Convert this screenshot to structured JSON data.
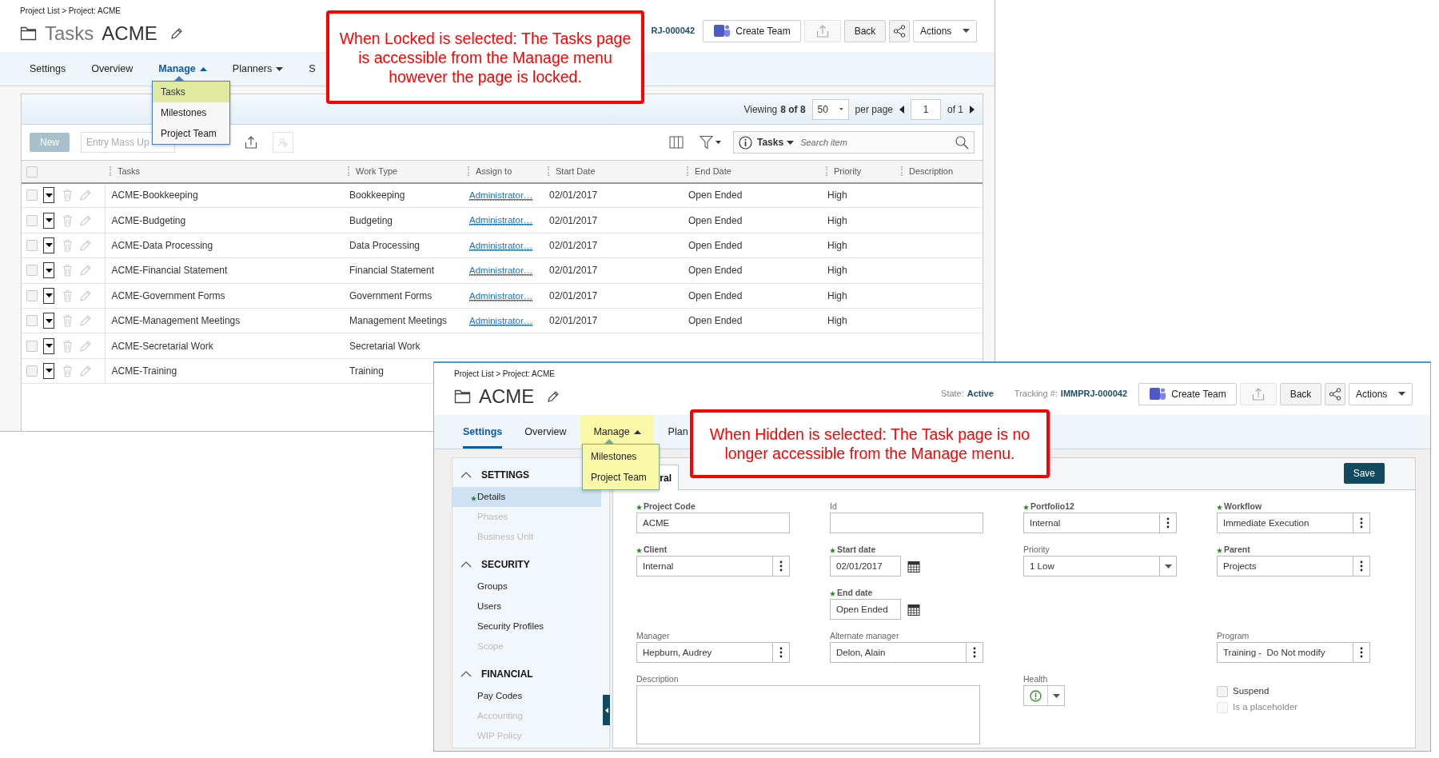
{
  "locked_view": {
    "breadcrumb": "Project List > Project: ACME",
    "title_prefix": "Tasks",
    "title": "ACME",
    "tracking_fragment": "RJ-000042",
    "buttons": [
      {
        "kind": "teams",
        "label": "Create Team"
      },
      {
        "kind": "export",
        "disabled": true
      },
      {
        "kind": "back",
        "label": "Back"
      },
      {
        "kind": "share"
      },
      {
        "kind": "actions",
        "label": "Actions"
      }
    ],
    "nav": [
      {
        "kind": "link",
        "label": "Settings",
        "selected": false,
        "highlighted": false
      },
      {
        "kind": "link",
        "label": "Overview",
        "selected": false,
        "highlighted": false
      },
      {
        "kind": "menu",
        "label": "Manage",
        "selected": true,
        "highlighted": false,
        "expanded": true
      },
      {
        "kind": "menu",
        "label": "Planners",
        "selected": false,
        "highlighted": false,
        "expanded": false
      },
      {
        "kind": "link",
        "label": "S",
        "selected": false,
        "highlighted": false
      }
    ],
    "menu": {
      "highlighted": false,
      "items": [
        {
          "label": "Tasks",
          "selected": true
        },
        {
          "label": "Milestones",
          "selected": false
        },
        {
          "label": "Project Team",
          "selected": false
        }
      ]
    },
    "pager": {
      "viewing_label": "Viewing",
      "viewing": "8 of 8",
      "page_size": "50",
      "per_page_label": "per page",
      "page": "1",
      "of": "of 1"
    },
    "toolbar": {
      "new_label": "New",
      "mass_update_placeholder": "Entry Mass Up",
      "search_scope": "Tasks",
      "search_placeholder": "Search item"
    },
    "all_checked": false,
    "columns": [
      "Tasks",
      "Work Type",
      "Assign to",
      "Start Date",
      "End Date",
      "Priority",
      "Description"
    ],
    "rows": [
      {
        "checked": false,
        "task": "ACME-Bookkeeping",
        "work_type": "Bookkeeping",
        "assign_to": "Administrator…",
        "start_date": "02/01/2017",
        "end_date": "Open Ended",
        "priority": "High"
      },
      {
        "checked": false,
        "task": "ACME-Budgeting",
        "work_type": "Budgeting",
        "assign_to": "Administrator…",
        "start_date": "02/01/2017",
        "end_date": "Open Ended",
        "priority": "High"
      },
      {
        "checked": false,
        "task": "ACME-Data Processing",
        "work_type": "Data Processing",
        "assign_to": "Administrator…",
        "start_date": "02/01/2017",
        "end_date": "Open Ended",
        "priority": "High"
      },
      {
        "checked": false,
        "task": "ACME-Financial Statement",
        "work_type": "Financial Statement",
        "assign_to": "Administrator…",
        "start_date": "02/01/2017",
        "end_date": "Open Ended",
        "priority": "High"
      },
      {
        "checked": false,
        "task": "ACME-Government Forms",
        "work_type": "Government Forms",
        "assign_to": "Administrator…",
        "start_date": "02/01/2017",
        "end_date": "Open Ended",
        "priority": "High"
      },
      {
        "checked": false,
        "task": "ACME-Management Meetings",
        "work_type": "Management Meetings",
        "assign_to": "Administrator…",
        "start_date": "02/01/2017",
        "end_date": "Open Ended",
        "priority": "High"
      },
      {
        "checked": false,
        "task": "ACME-Secretarial Work",
        "work_type": "Secretarial Work"
      },
      {
        "checked": false,
        "task": "ACME-Training",
        "work_type": "Training"
      }
    ]
  },
  "hidden_view": {
    "breadcrumb": "Project List > Project: ACME",
    "title": "ACME",
    "state_label": "State:",
    "state": "Active",
    "tracking_label": "Tracking #:",
    "tracking": "IMMPRJ-000042",
    "buttons": [
      {
        "kind": "teams",
        "label": "Create Team"
      },
      {
        "kind": "export",
        "disabled": true
      },
      {
        "kind": "back",
        "label": "Back"
      },
      {
        "kind": "share"
      },
      {
        "kind": "actions",
        "label": "Actions"
      }
    ],
    "nav": [
      {
        "kind": "link",
        "label": "Settings",
        "selected": true,
        "highlighted": false
      },
      {
        "kind": "link",
        "label": "Overview",
        "selected": false,
        "highlighted": false
      },
      {
        "kind": "menu",
        "label": "Manage",
        "selected": false,
        "highlighted": true,
        "expanded": true
      },
      {
        "kind": "link",
        "label": "Plan",
        "selected": false,
        "highlighted": false
      }
    ],
    "menu": {
      "highlighted": true,
      "items": [
        {
          "label": "Milestones",
          "selected": false
        },
        {
          "label": "Project Team",
          "selected": false
        }
      ]
    },
    "sidebar": [
      {
        "title": "SETTINGS",
        "expanded": true,
        "items": [
          {
            "label": "Details",
            "selected": true,
            "disabled": false,
            "required": true
          },
          {
            "label": "Phases",
            "selected": false,
            "disabled": true,
            "required": false
          },
          {
            "label": "Business Unit",
            "selected": false,
            "disabled": true,
            "required": false
          }
        ]
      },
      {
        "title": "SECURITY",
        "expanded": true,
        "items": [
          {
            "label": "Groups",
            "selected": false,
            "disabled": false,
            "required": false
          },
          {
            "label": "Users",
            "selected": false,
            "disabled": false,
            "required": false
          },
          {
            "label": "Security Profiles",
            "selected": false,
            "disabled": false,
            "required": false
          },
          {
            "label": "Scope",
            "selected": false,
            "disabled": true,
            "required": false
          }
        ]
      },
      {
        "title": "FINANCIAL",
        "expanded": true,
        "items": [
          {
            "label": "Pay Codes",
            "selected": false,
            "disabled": false,
            "required": false
          },
          {
            "label": "Accounting",
            "selected": false,
            "disabled": true,
            "required": false
          },
          {
            "label": "WIP Policy",
            "selected": false,
            "disabled": true,
            "required": false
          }
        ]
      }
    ],
    "form_tab": "ral",
    "save_label": "Save",
    "form_rows": [
      [
        {
          "kind": "text",
          "label": "Project Code",
          "required": true,
          "value": "ACME"
        },
        {
          "kind": "text",
          "label": "Id",
          "required": false
        },
        {
          "kind": "lookup",
          "label": "Portfolio12",
          "required": true,
          "value": "Internal"
        },
        {
          "kind": "lookup",
          "label": "Workflow",
          "required": true,
          "value": "Immediate Execution"
        }
      ],
      [
        {
          "kind": "lookup",
          "label": "Client",
          "required": true,
          "value": "Internal"
        },
        {
          "kind": "date",
          "label": "Start date",
          "required": true,
          "value": "02/01/2017"
        },
        {
          "kind": "select",
          "label": "Priority",
          "required": false,
          "value": "1 Low"
        },
        {
          "kind": "lookup",
          "label": "Parent",
          "required": true,
          "value": "Projects"
        }
      ],
      [
        {
          "kind": "empty"
        },
        {
          "kind": "date",
          "label": "End date",
          "required": true,
          "value": "Open Ended"
        },
        {
          "kind": "empty"
        },
        {
          "kind": "empty"
        }
      ],
      [
        {
          "kind": "lookup",
          "label": "Manager",
          "required": false,
          "value": "Hepburn, Audrey"
        },
        {
          "kind": "lookup",
          "label": "Alternate manager",
          "required": false,
          "value": "Delon, Alain"
        },
        {
          "kind": "empty"
        },
        {
          "kind": "lookup",
          "label": "Program",
          "required": false,
          "value": "Training -  Do Not modify"
        }
      ],
      [
        {
          "kind": "textarea",
          "label": "Description",
          "required": false
        },
        {
          "kind": "health",
          "label": "Health",
          "required": false
        },
        {
          "kind": "checks",
          "items": [
            {
              "label": "Suspend",
              "checked": false,
              "disabled": false
            },
            {
              "label": "Is a placeholder",
              "checked": false,
              "disabled": true
            }
          ]
        }
      ]
    ]
  },
  "callouts": [
    {
      "lines": [
        "When Locked is selected: The Tasks page",
        "is accessible from the Manage menu",
        "however the page is locked."
      ]
    },
    {
      "lines": [
        "When Hidden is selected: The Task page is no",
        "longer accessible from the Manage menu."
      ]
    }
  ]
}
